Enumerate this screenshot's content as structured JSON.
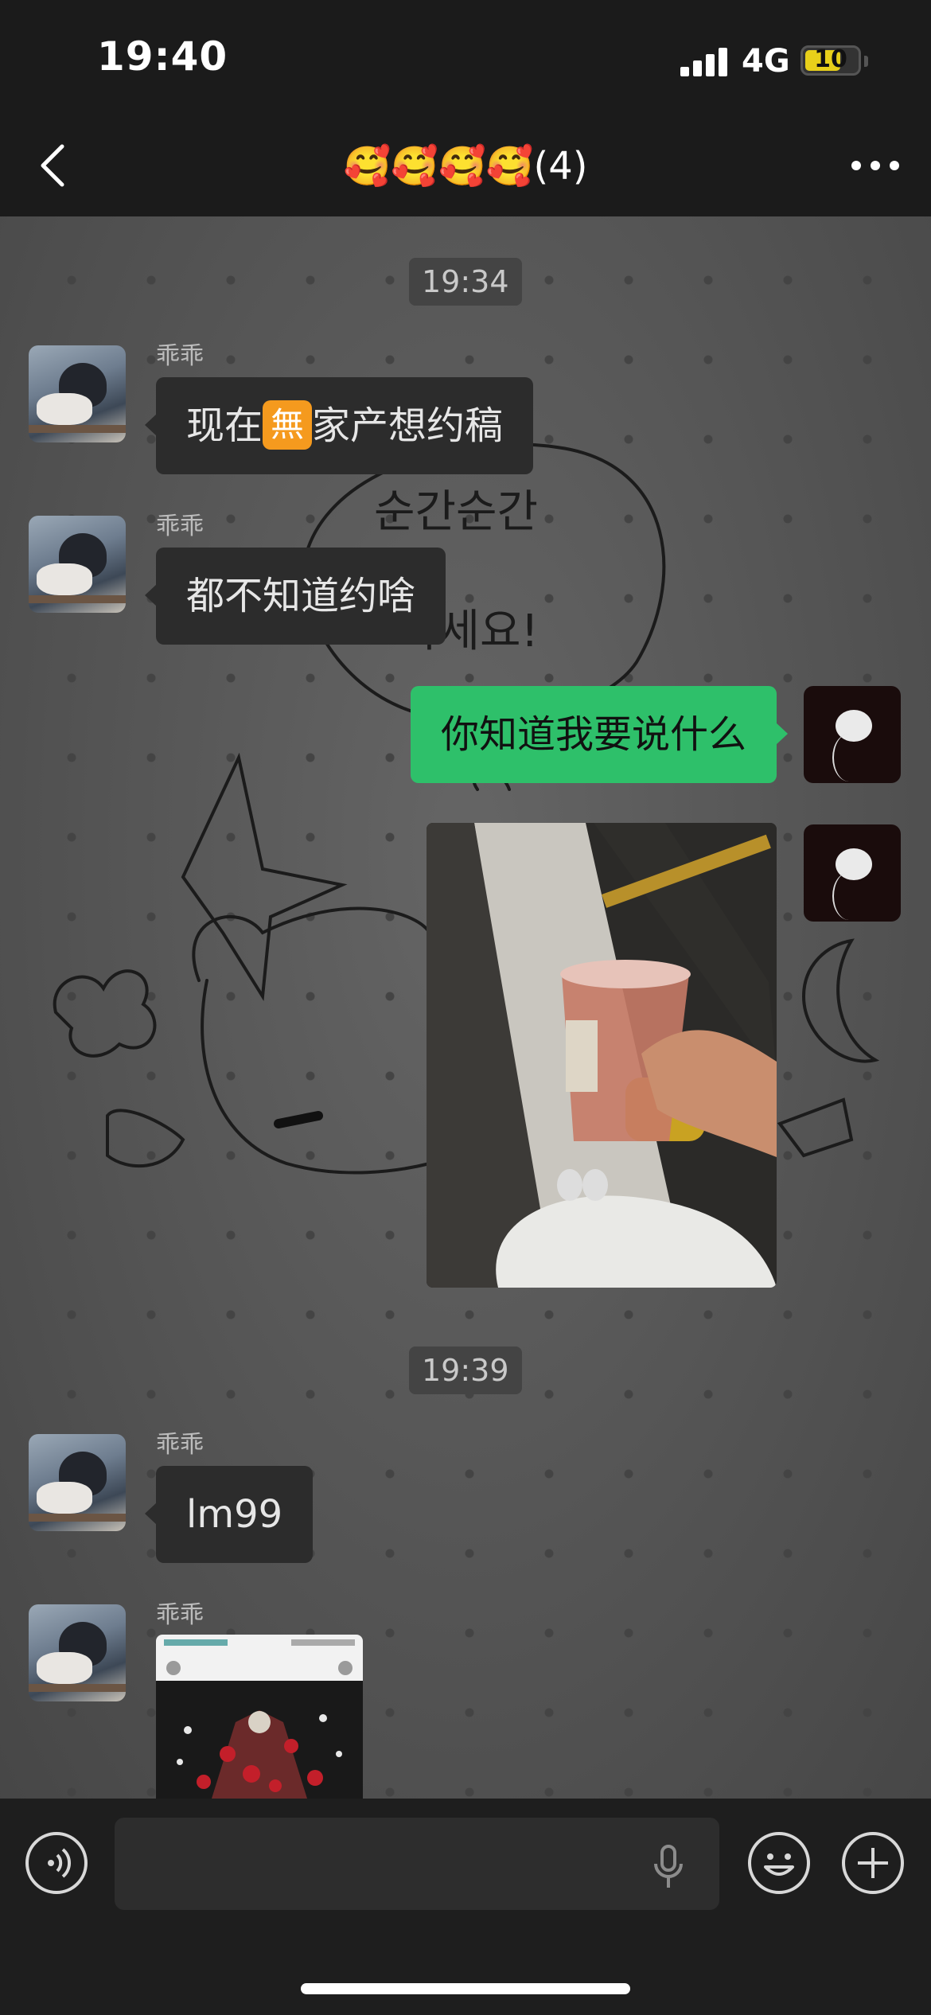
{
  "status": {
    "time": "19:40",
    "network": "4G",
    "battery": "10"
  },
  "header": {
    "title": "🥰🥰🥰🥰(4)"
  },
  "messages": {
    "ts1": "19:34",
    "ts2": "19:39",
    "sender_name": "乖乖",
    "m1_pre": "现在",
    "m1_badge": "無",
    "m1_post": "家产想约稿",
    "m2": "都不知道约啥",
    "m3": "你知道我要说什么",
    "m5": "lm99"
  },
  "icons": {
    "back": "chevron-left-icon",
    "more": "more-dots-icon",
    "voice": "voice-icon",
    "mic": "microphone-icon",
    "emoji": "emoji-icon",
    "add": "plus-icon"
  },
  "colors": {
    "bubble_me": "#2ec06a",
    "bubble_other": "#2c2c2c",
    "badge": "#f59a1e"
  }
}
